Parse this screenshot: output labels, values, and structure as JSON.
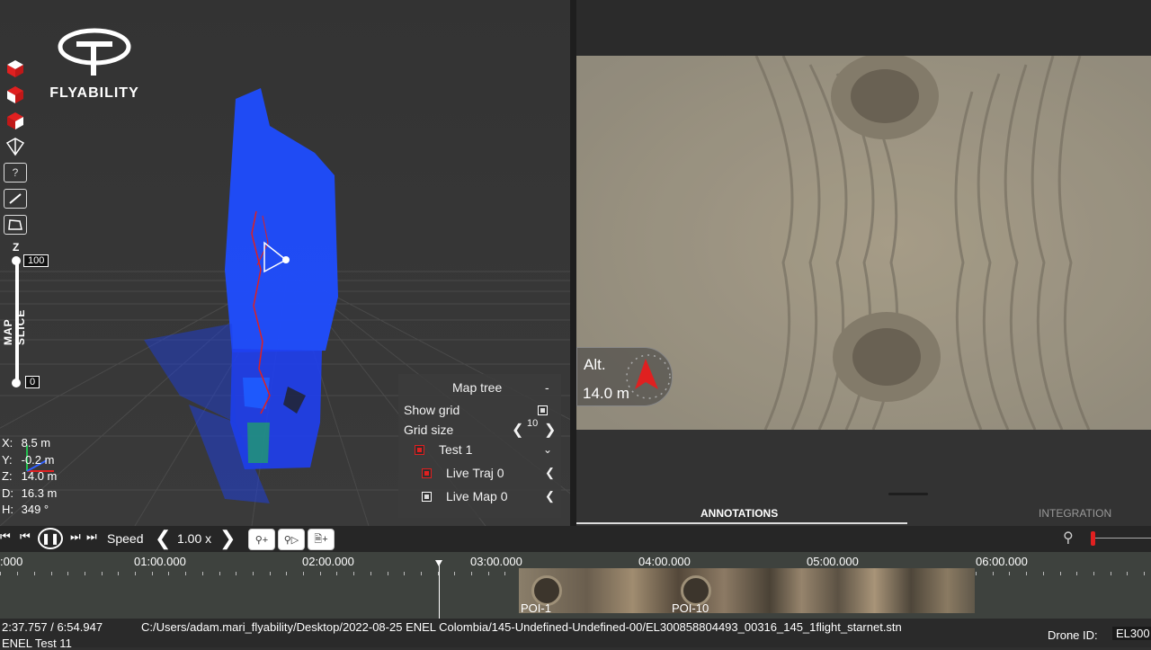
{
  "brand": {
    "name": "FLYABILITY"
  },
  "left_toolbar": {
    "items": [
      {
        "icon": "cube-red-icon"
      },
      {
        "icon": "cube-red-icon"
      },
      {
        "icon": "cube-red-icon"
      },
      {
        "icon": "cube-outline-icon"
      },
      {
        "icon": "help-icon",
        "label": "?"
      },
      {
        "icon": "ruler-icon"
      },
      {
        "icon": "polygon-measure-icon"
      }
    ]
  },
  "map_slice": {
    "label": "MAP SLICE",
    "axis": "Z",
    "top_value": "100",
    "bottom_value": "0"
  },
  "coordinates": {
    "x": {
      "key": "X:",
      "value": "8.5 m"
    },
    "y": {
      "key": "Y:",
      "value": "-0.2 m"
    },
    "z": {
      "key": "Z:",
      "value": "14.0 m"
    },
    "d": {
      "key": "D:",
      "value": "16.3 m"
    },
    "h": {
      "key": "H:",
      "value": "349 °"
    }
  },
  "map_tree": {
    "title": "Map tree",
    "collapse": "-",
    "show_grid": "Show grid",
    "grid_size_label": "Grid size",
    "grid_size_value": "10",
    "items": [
      {
        "label": "Test 1",
        "color": "#e02020"
      },
      {
        "label": "Live Traj 0",
        "color": "#e02020"
      },
      {
        "label": "Live Map 0",
        "color": "#ffffff"
      }
    ]
  },
  "altitude": {
    "label": "Alt.",
    "value": "14.0 m"
  },
  "tabs": {
    "annotations": "ANNOTATIONS",
    "integration": "INTEGRATION"
  },
  "playback": {
    "speed_label": "Speed",
    "speed_value": "1.00 x"
  },
  "timeline": {
    "labels": [
      ":000",
      "01:00.000",
      "02:00.000",
      "03:00.000",
      "04:00.000",
      "05:00.000",
      "06:00.000"
    ],
    "pois": [
      "POI-1",
      "POI-10"
    ],
    "cursor_fraction": 0.39
  },
  "status": {
    "time": "2:37.757 / 6:54.947",
    "path": "C:/Users/adam.mari_flyability/Desktop/2022-08-25 ENEL Colombia/145-Undefined-Undefined-00/EL300858804493_00316_145_1flight_starnet.stn",
    "project": "ENEL Test 11",
    "drone_label": "Drone ID:",
    "drone_value": "EL300"
  },
  "colors": {
    "accent_red": "#e02020",
    "pointcloud_blue": "#1f4dff"
  }
}
